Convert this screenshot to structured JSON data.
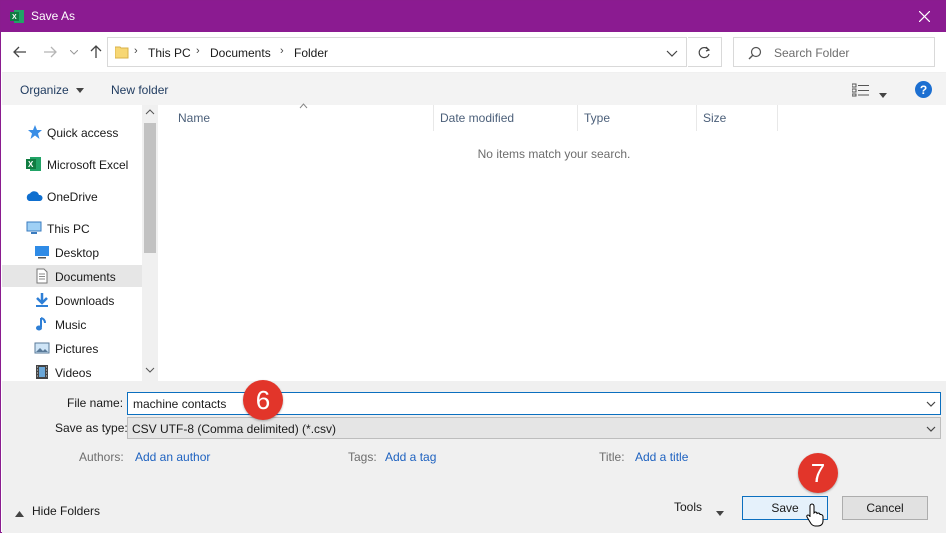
{
  "window": {
    "title": "Save As",
    "app_icon": "excel-icon",
    "accent": "#8b1b91"
  },
  "navigation": {
    "breadcrumbs": [
      "This PC",
      "Documents",
      "Folder"
    ],
    "search_placeholder": "Search Folder"
  },
  "commands": {
    "organize": "Organize",
    "new_folder": "New folder"
  },
  "sidebar": {
    "items": [
      {
        "label": "Quick access",
        "icon": "star-icon"
      },
      {
        "label": "Microsoft Excel",
        "icon": "excel-icon"
      },
      {
        "label": "OneDrive",
        "icon": "cloud-icon"
      },
      {
        "label": "This PC",
        "icon": "computer-icon"
      },
      {
        "label": "Desktop",
        "icon": "desktop-icon"
      },
      {
        "label": "Documents",
        "icon": "documents-icon",
        "selected": true
      },
      {
        "label": "Downloads",
        "icon": "download-icon"
      },
      {
        "label": "Music",
        "icon": "music-icon"
      },
      {
        "label": "Pictures",
        "icon": "pictures-icon"
      },
      {
        "label": "Videos",
        "icon": "videos-icon"
      }
    ]
  },
  "filelist": {
    "columns": [
      "Name",
      "Date modified",
      "Type",
      "Size"
    ],
    "empty_message": "No items match your search."
  },
  "form": {
    "file_name_label": "File name:",
    "file_name_value": "machine contacts",
    "save_type_label": "Save as type:",
    "save_type_value": "CSV UTF-8 (Comma delimited) (*.csv)",
    "authors_label": "Authors:",
    "authors_link": "Add an author",
    "tags_label": "Tags:",
    "tags_link": "Add a tag",
    "title_label": "Title:",
    "title_link": "Add a title"
  },
  "footer": {
    "hide_folders": "Hide Folders",
    "tools": "Tools",
    "save": "Save",
    "cancel": "Cancel"
  },
  "annotations": {
    "step_6": "6",
    "step_7": "7",
    "badge_color": "#e2352a"
  }
}
